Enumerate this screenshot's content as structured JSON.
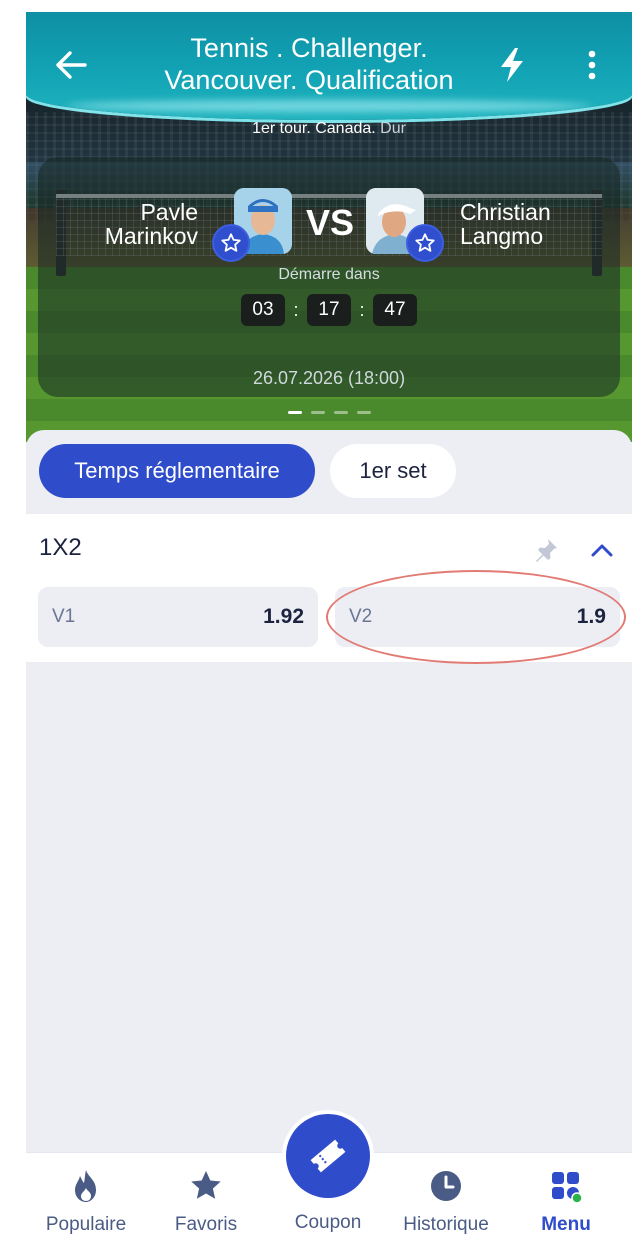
{
  "header": {
    "title_line1": "Tennis . Challenger.",
    "title_line2": "Vancouver. Qualification",
    "subtitle_main": "1er tour. Canada. ",
    "subtitle_surface": "Dur"
  },
  "match": {
    "player1": {
      "first": "Pavle",
      "last": "Marinkov"
    },
    "player2": {
      "first": "Christian",
      "last": "Langmo"
    },
    "vs": "VS",
    "starts_label": "Démarre dans",
    "countdown": {
      "hours": "03",
      "minutes": "17",
      "seconds": "47"
    },
    "separator": ":",
    "datetime": "26.07.2026 (18:00)",
    "slides_total": 4,
    "slide_active": 1
  },
  "tabs": [
    {
      "label": "Temps réglementaire",
      "active": true
    },
    {
      "label": "1er set",
      "active": false
    }
  ],
  "market": {
    "title": "1X2",
    "odds": [
      {
        "label": "V1",
        "value": "1.92"
      },
      {
        "label": "V2",
        "value": "1.9"
      }
    ]
  },
  "bottom_nav": {
    "items": [
      {
        "label": "Populaire",
        "icon": "flame-icon"
      },
      {
        "label": "Favoris",
        "icon": "star-icon"
      },
      {
        "label": "Coupon",
        "icon": "ticket-icon"
      },
      {
        "label": "Historique",
        "icon": "clock-icon"
      },
      {
        "label": "Menu",
        "icon": "grid-icon",
        "active": true
      }
    ]
  },
  "colors": {
    "accent": "#2f4ccb",
    "header_teal": "#12a3b5",
    "highlight_circle": "#e27b74",
    "badge_green": "#2db24a"
  }
}
